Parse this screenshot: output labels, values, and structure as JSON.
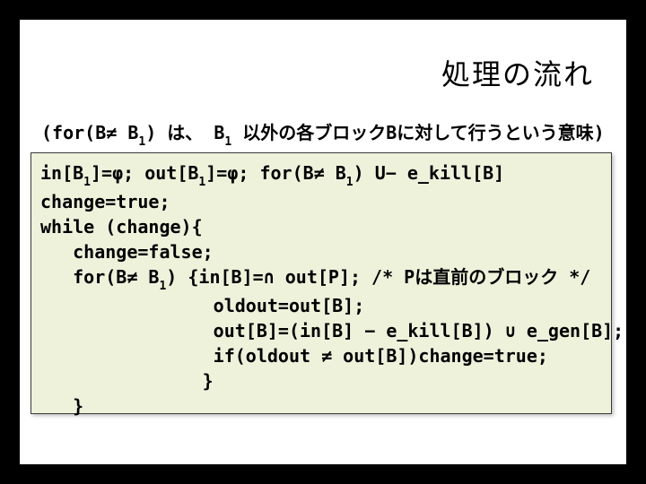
{
  "title": "処理の流れ",
  "note": {
    "pre": "(for(B≠ B",
    "sub1": "1",
    "mid1": ") は、 B",
    "sub2": "1",
    "post": " 以外の各ブロックBに対して行うという意味)"
  },
  "code": {
    "l1a": "in[B",
    "l1s1": "1",
    "l1b": "]=φ; out[B",
    "l1s2": "1",
    "l1c": "]=φ; for(B≠ B",
    "l1s3": "1",
    "l1d": ") U− e_kill[B]",
    "l2": "change=true;",
    "l3": "while (change){",
    "l4": "   change=false;",
    "l5a": "   for(B≠ B",
    "l5s1": "1",
    "l5b": ") {in[B]=∩ out[P]; /* Pは直前のブロック */",
    "l6": "                oldout=out[B];",
    "l7": "                out[B]=(in[B] − e_kill[B]) ∪ e_gen[B];",
    "l8": "                if(oldout ≠ out[B])change=true;",
    "l9": "               }",
    "l10": "   }"
  }
}
